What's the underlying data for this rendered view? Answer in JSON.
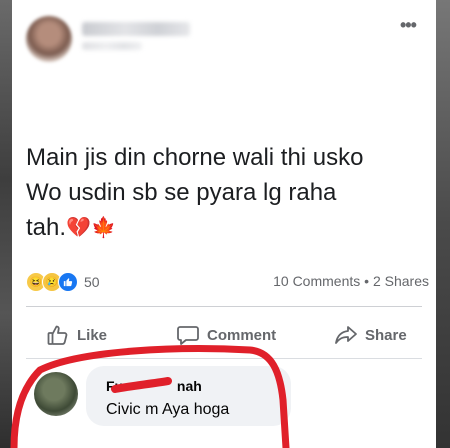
{
  "post": {
    "author_name": "",
    "text_line1": "Main jis din chorne wali thi usko",
    "text_line2": "Wo usdin sb se pyara lg raha",
    "text_line3": "tah.",
    "emoji_broken_heart": "💔",
    "emoji_maple_leaf": "🍁"
  },
  "reactions": {
    "icons": [
      "haha-icon",
      "sad-icon",
      "like-icon"
    ],
    "count": "50",
    "comments": "10 Comments",
    "separator": "•",
    "shares": "2 Shares"
  },
  "actions": {
    "like": "Like",
    "comment": "Comment",
    "share": "Share"
  },
  "comment": {
    "author": "Fu  Shah",
    "author_left": "Fu",
    "author_right": "nah",
    "text": "Civic m Aya hoga"
  },
  "colors": {
    "accent": "#1877f2",
    "text_secondary": "#65676b",
    "scribble": "#e0202a"
  }
}
